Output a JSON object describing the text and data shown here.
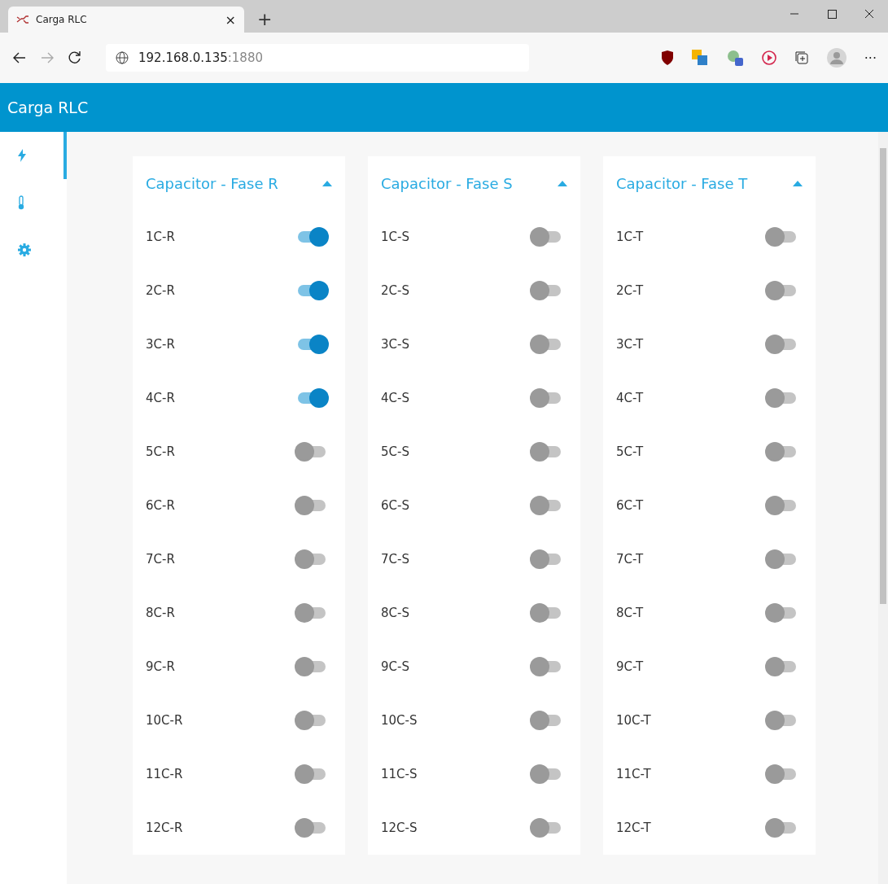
{
  "browser": {
    "tab": {
      "title": "Carga RLC",
      "close": "×"
    },
    "new_tab": "+",
    "address": {
      "host": "192.168.0.135",
      "port": ":1880"
    },
    "more": "···"
  },
  "header": {
    "title": "Carga RLC"
  },
  "sidebar": {
    "items": [
      {
        "kind": "bolt",
        "selected": true
      },
      {
        "kind": "thermometer",
        "selected": false
      },
      {
        "kind": "gear",
        "selected": false
      }
    ]
  },
  "groups": [
    {
      "title": "Capacitor - Fase R",
      "expanded": true,
      "switches": [
        {
          "label": "1C-R",
          "on": true
        },
        {
          "label": "2C-R",
          "on": true
        },
        {
          "label": "3C-R",
          "on": true
        },
        {
          "label": "4C-R",
          "on": true
        },
        {
          "label": "5C-R",
          "on": false
        },
        {
          "label": "6C-R",
          "on": false
        },
        {
          "label": "7C-R",
          "on": false
        },
        {
          "label": "8C-R",
          "on": false
        },
        {
          "label": "9C-R",
          "on": false
        },
        {
          "label": "10C-R",
          "on": false
        },
        {
          "label": "11C-R",
          "on": false
        },
        {
          "label": "12C-R",
          "on": false
        }
      ]
    },
    {
      "title": "Capacitor - Fase S",
      "expanded": true,
      "switches": [
        {
          "label": "1C-S",
          "on": false
        },
        {
          "label": "2C-S",
          "on": false
        },
        {
          "label": "3C-S",
          "on": false
        },
        {
          "label": "4C-S",
          "on": false
        },
        {
          "label": "5C-S",
          "on": false
        },
        {
          "label": "6C-S",
          "on": false
        },
        {
          "label": "7C-S",
          "on": false
        },
        {
          "label": "8C-S",
          "on": false
        },
        {
          "label": "9C-S",
          "on": false
        },
        {
          "label": "10C-S",
          "on": false
        },
        {
          "label": "11C-S",
          "on": false
        },
        {
          "label": "12C-S",
          "on": false
        }
      ]
    },
    {
      "title": "Capacitor - Fase T",
      "expanded": true,
      "switches": [
        {
          "label": "1C-T",
          "on": false
        },
        {
          "label": "2C-T",
          "on": false
        },
        {
          "label": "3C-T",
          "on": false
        },
        {
          "label": "4C-T",
          "on": false
        },
        {
          "label": "5C-T",
          "on": false
        },
        {
          "label": "6C-T",
          "on": false
        },
        {
          "label": "7C-T",
          "on": false
        },
        {
          "label": "8C-T",
          "on": false
        },
        {
          "label": "9C-T",
          "on": false
        },
        {
          "label": "10C-T",
          "on": false
        },
        {
          "label": "11C-T",
          "on": false
        },
        {
          "label": "12C-T",
          "on": false
        }
      ]
    }
  ]
}
